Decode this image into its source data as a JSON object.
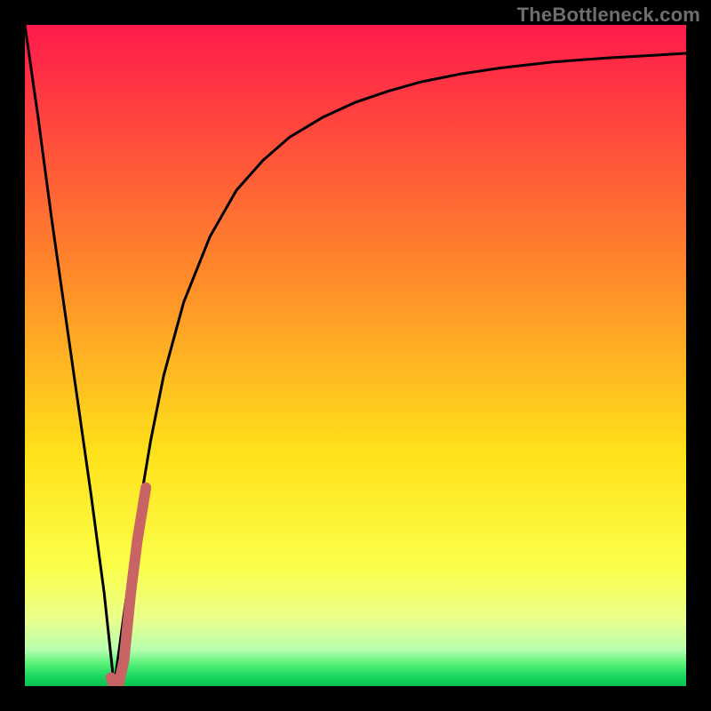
{
  "watermark": "TheBottleneck.com",
  "colors": {
    "frame": "#000000",
    "curve": "#000000",
    "highlight": "#c86464",
    "gradient_stops": [
      {
        "offset": 0.0,
        "color": "#ff1a4b"
      },
      {
        "offset": 0.38,
        "color": "#ff8a2a"
      },
      {
        "offset": 0.65,
        "color": "#ffe21a"
      },
      {
        "offset": 0.82,
        "color": "#fbff4a"
      },
      {
        "offset": 0.9,
        "color": "#eaff8c"
      },
      {
        "offset": 0.945,
        "color": "#b7ffb0"
      },
      {
        "offset": 0.965,
        "color": "#5cf27a"
      },
      {
        "offset": 0.985,
        "color": "#18d860"
      },
      {
        "offset": 1.0,
        "color": "#0cc050"
      }
    ]
  },
  "chart_data": {
    "type": "line",
    "title": "",
    "xlabel": "",
    "ylabel": "",
    "xlim": [
      0,
      100
    ],
    "ylim": [
      0,
      100
    ],
    "grid": false,
    "legend": false,
    "series": [
      {
        "name": "bottleneck-curve",
        "x": [
          0,
          2,
          4,
          6,
          8,
          10,
          12,
          13.5,
          15,
          17,
          19,
          21,
          24,
          28,
          32,
          36,
          40,
          45,
          50,
          55,
          60,
          66,
          72,
          80,
          88,
          95,
          100
        ],
        "y": [
          100,
          86,
          71,
          57,
          43,
          29,
          14,
          0,
          11,
          25,
          37,
          47,
          58,
          68,
          75,
          79.5,
          83,
          86,
          88.3,
          90,
          91.4,
          92.6,
          93.5,
          94.4,
          95,
          95.4,
          95.7
        ]
      }
    ],
    "highlight_segment": {
      "name": "minimum-region",
      "x": [
        13.0,
        13.5,
        14.2,
        15.0,
        16.0,
        17.0,
        18.3
      ],
      "y": [
        1.3,
        0.0,
        0.3,
        4.0,
        14.0,
        22.0,
        30.0
      ]
    }
  }
}
